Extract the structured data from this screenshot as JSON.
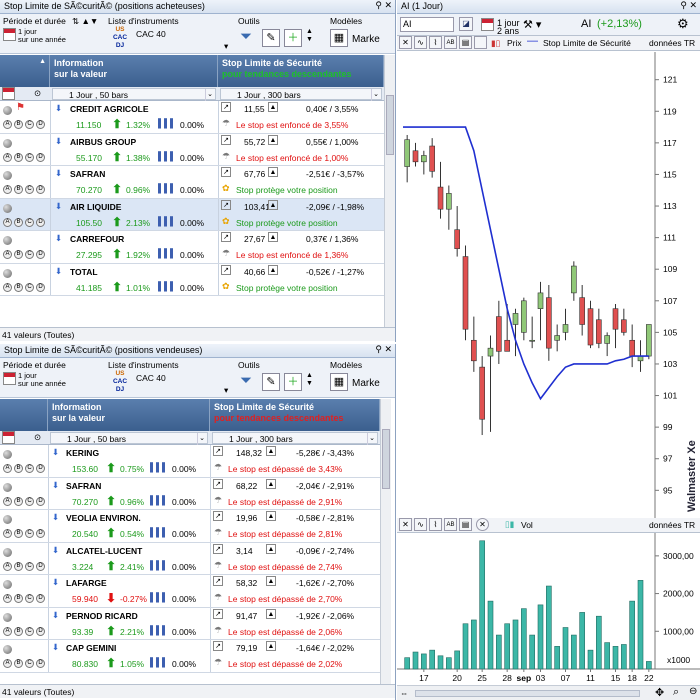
{
  "top_panel": {
    "title": "Stop Limite de SÃ©curitÃ© (positions acheteuses)",
    "period_label": "Période et durée",
    "period_value_1": "1 jour",
    "period_value_2": "sur une année",
    "instruments_label": "Liste d'instruments",
    "instrument_value": "CAC 40",
    "tools_label": "Outils",
    "models_label": "Modèles",
    "models_value": "Marke",
    "col_info_1": "Information",
    "col_info_2": "sur la valeur",
    "col_stop_1": "Stop Limite de Sécurité",
    "col_stop_2": "pour tendances descendantes",
    "sel_left": "1 Jour , 50 bars",
    "sel_right": "1 Jour , 300 bars",
    "rows": [
      {
        "name": "CREDIT AGRICOLE",
        "price": "11.150",
        "change": "1.32%",
        "pct": "0.00%",
        "level": "11,55",
        "diff": "0,40€ / 3,55%",
        "status": "Le stop est enfoncé de 3,55%",
        "status_type": "red"
      },
      {
        "name": "AIRBUS GROUP",
        "price": "55.170",
        "change": "1.38%",
        "pct": "0.00%",
        "level": "55,72",
        "diff": "0,55€ / 1,00%",
        "status": "Le stop est enfoncé de 1,00%",
        "status_type": "red"
      },
      {
        "name": "SAFRAN",
        "price": "70.270",
        "change": "0.96%",
        "pct": "0.00%",
        "level": "67,76",
        "diff": "-2,51€ / -3,57%",
        "status": "Stop protège votre position",
        "status_type": "green"
      },
      {
        "name": "AIR LIQUIDE",
        "price": "105.50",
        "change": "2.13%",
        "pct": "0.00%",
        "level": "103,41",
        "diff": "-2,09€ / -1,98%",
        "status": "Stop protège votre position",
        "status_type": "green"
      },
      {
        "name": "CARREFOUR",
        "price": "27.295",
        "change": "1.92%",
        "pct": "0.00%",
        "level": "27,67",
        "diff": "0,37€ / 1,36%",
        "status": "Le stop est enfoncé de 1,36%",
        "status_type": "red"
      },
      {
        "name": "TOTAL",
        "price": "41.185",
        "change": "1.01%",
        "pct": "0.00%",
        "level": "40,66",
        "diff": "-0,52€ / -1,27%",
        "status": "Stop protège votre position",
        "status_type": "green"
      }
    ],
    "footer": "41 valeurs (Toutes)"
  },
  "bottom_panel": {
    "title": "Stop Limite de SÃ©curitÃ© (positions vendeuses)",
    "period_label": "Période et durée",
    "period_value_1": "1 jour",
    "period_value_2": "sur une année",
    "instruments_label": "Liste d'instruments",
    "instrument_value": "CAC 40",
    "tools_label": "Outils",
    "models_label": "Modèles",
    "models_value": "Marke",
    "col_info_1": "Information",
    "col_info_2": "sur la valeur",
    "col_stop_1": "Stop Limite de Sécurité",
    "col_stop_2": "pour tendances descendantes",
    "sel_left": "1 Jour , 50 bars",
    "sel_right": "1 Jour , 300 bars",
    "rows": [
      {
        "name": "KERING",
        "price": "153.60",
        "change": "0.75%",
        "dir": "up",
        "pct": "0.00%",
        "level": "148,32",
        "diff": "-5,28€ / -3,43%",
        "status": "Le stop est dépassé de 3,43%"
      },
      {
        "name": "SAFRAN",
        "price": "70.270",
        "change": "0.96%",
        "dir": "up",
        "pct": "0.00%",
        "level": "68,22",
        "diff": "-2,04€ / -2,91%",
        "status": "Le stop est dépassé de 2,91%"
      },
      {
        "name": "VEOLIA ENVIRON.",
        "price": "20.540",
        "change": "0.54%",
        "dir": "up",
        "pct": "0.00%",
        "level": "19,96",
        "diff": "-0,58€ / -2,81%",
        "status": "Le stop est dépassé de 2,81%"
      },
      {
        "name": "ALCATEL-LUCENT",
        "price": "3.224",
        "change": "2.41%",
        "dir": "up",
        "pct": "0.00%",
        "level": "3,14",
        "diff": "-0,09€ / -2,74%",
        "status": "Le stop est dépassé de 2,74%"
      },
      {
        "name": "LAFARGE",
        "price": "59.940",
        "change": "-0.27%",
        "dir": "down",
        "pct": "0.00%",
        "level": "58,32",
        "diff": "-1,62€ / -2,70%",
        "status": "Le stop est dépassé de 2,70%"
      },
      {
        "name": "PERNOD RICARD",
        "price": "93.39",
        "change": "2.21%",
        "dir": "up",
        "pct": "0.00%",
        "level": "91,47",
        "diff": "-1,92€ / -2,06%",
        "status": "Le stop est dépassé de 2,06%"
      },
      {
        "name": "CAP GEMINI",
        "price": "80.830",
        "change": "1.05%",
        "dir": "up",
        "pct": "0.00%",
        "level": "79,19",
        "diff": "-1,64€ / -2,02%",
        "status": "Le stop est dépassé de 2,02%"
      }
    ],
    "footer": "41 valeurs (Toutes)"
  },
  "chart_panel": {
    "title": "AI (1 Jour)",
    "symbol": "AI",
    "period_1": "1 jour",
    "period_2": "2 ans",
    "symbol_label": "AI",
    "change": "(+2,13%)",
    "legend_price": "Prix",
    "legend_stop": "Stop Limite de Sécurité",
    "legend_tr": "données TR",
    "vol_label": "Vol",
    "vol_tr": "données TR",
    "watermark": "Walmaster Xe",
    "vol_unit": "x1000",
    "y_ticks": [
      "121",
      "119",
      "117",
      "115",
      "113",
      "111",
      "109",
      "107",
      "105",
      "103",
      "101",
      "99",
      "97",
      "95"
    ],
    "vol_ticks": [
      "3000,00",
      "2000,00",
      "1000,00"
    ],
    "x_ticks": [
      "17",
      "20",
      "25",
      "28",
      "sep",
      "03",
      "07",
      "11",
      "15",
      "18",
      "22"
    ]
  },
  "chart_data": [
    {
      "type": "candlestick",
      "title": "AI (1 Jour)",
      "ylim": [
        93.5,
        122.5
      ],
      "candles": [
        {
          "o": 115.5,
          "h": 117.5,
          "l": 114.5,
          "c": 117.2
        },
        {
          "o": 116.5,
          "h": 117,
          "l": 115.5,
          "c": 115.8
        },
        {
          "o": 115.8,
          "h": 116.5,
          "l": 115,
          "c": 116.2
        },
        {
          "o": 116.8,
          "h": 117.3,
          "l": 114.8,
          "c": 115.2
        },
        {
          "o": 114.2,
          "h": 115.8,
          "l": 112.2,
          "c": 112.8
        },
        {
          "o": 112.8,
          "h": 114.3,
          "l": 111.5,
          "c": 113.8
        },
        {
          "o": 111.5,
          "h": 113,
          "l": 109.8,
          "c": 110.3
        },
        {
          "o": 109.8,
          "h": 110.5,
          "l": 104.5,
          "c": 105.2
        },
        {
          "o": 104.5,
          "h": 106,
          "l": 102.5,
          "c": 103.2
        },
        {
          "o": 102.8,
          "h": 103.5,
          "l": 98.5,
          "c": 99.5
        },
        {
          "o": 103.5,
          "h": 104.8,
          "l": 98.7,
          "c": 104
        },
        {
          "o": 106,
          "h": 107,
          "l": 103,
          "c": 103.8
        },
        {
          "o": 104.5,
          "h": 106.8,
          "l": 103.8,
          "c": 103.8
        },
        {
          "o": 105.5,
          "h": 106.5,
          "l": 103.5,
          "c": 106.2
        },
        {
          "o": 105,
          "h": 107.2,
          "l": 104.5,
          "c": 107
        },
        {
          "o": 104.5,
          "h": 106,
          "l": 104,
          "c": 104.5
        },
        {
          "o": 106.5,
          "h": 108.2,
          "l": 104.5,
          "c": 107.5
        },
        {
          "o": 107.2,
          "h": 108,
          "l": 103.2,
          "c": 104
        },
        {
          "o": 104.5,
          "h": 105.5,
          "l": 103.8,
          "c": 104.8
        },
        {
          "o": 105,
          "h": 106.5,
          "l": 104.5,
          "c": 105.5
        },
        {
          "o": 107.5,
          "h": 109.5,
          "l": 107,
          "c": 109.2
        },
        {
          "o": 107.2,
          "h": 108,
          "l": 104.8,
          "c": 105.5
        },
        {
          "o": 106.5,
          "h": 107,
          "l": 104,
          "c": 104.2
        },
        {
          "o": 105.8,
          "h": 106.5,
          "l": 104,
          "c": 104.3
        },
        {
          "o": 104.3,
          "h": 105,
          "l": 103.5,
          "c": 104.8
        },
        {
          "o": 106.5,
          "h": 106.8,
          "l": 104,
          "c": 105.2
        },
        {
          "o": 105.8,
          "h": 106.5,
          "l": 104.8,
          "c": 105
        },
        {
          "o": 104.5,
          "h": 105.5,
          "l": 102.8,
          "c": 103.5
        },
        {
          "o": 103.2,
          "h": 104.5,
          "l": 102.5,
          "c": 103.5
        },
        {
          "o": 103.5,
          "h": 105.5,
          "l": 103.3,
          "c": 105.5
        }
      ],
      "stop_line": [
        118,
        118,
        118,
        118,
        118,
        118,
        118,
        118,
        116.5,
        114,
        111.5,
        109,
        106.5,
        104.5,
        103,
        101.8,
        100.8,
        101.5,
        102.2,
        102.8,
        103,
        103,
        103,
        103,
        103,
        103.2,
        103.3,
        103.5,
        103.5,
        103.5
      ],
      "volume_ylim": [
        0,
        3500
      ],
      "volumes": [
        300,
        450,
        400,
        500,
        350,
        300,
        480,
        1200,
        1300,
        3400,
        1800,
        900,
        1200,
        1300,
        1600,
        900,
        1700,
        2200,
        600,
        1100,
        900,
        1500,
        500,
        1400,
        700,
        600,
        650,
        1800,
        2350,
        200
      ]
    }
  ],
  "colors": {
    "header_blue": "#3b5f8e",
    "up_green": "#1c9a1c",
    "down_red": "#e01010",
    "candle_up": "#90c878",
    "candle_down": "#e05050",
    "stop_line": "#1f2fd0",
    "volume": "#3cb7a7"
  }
}
